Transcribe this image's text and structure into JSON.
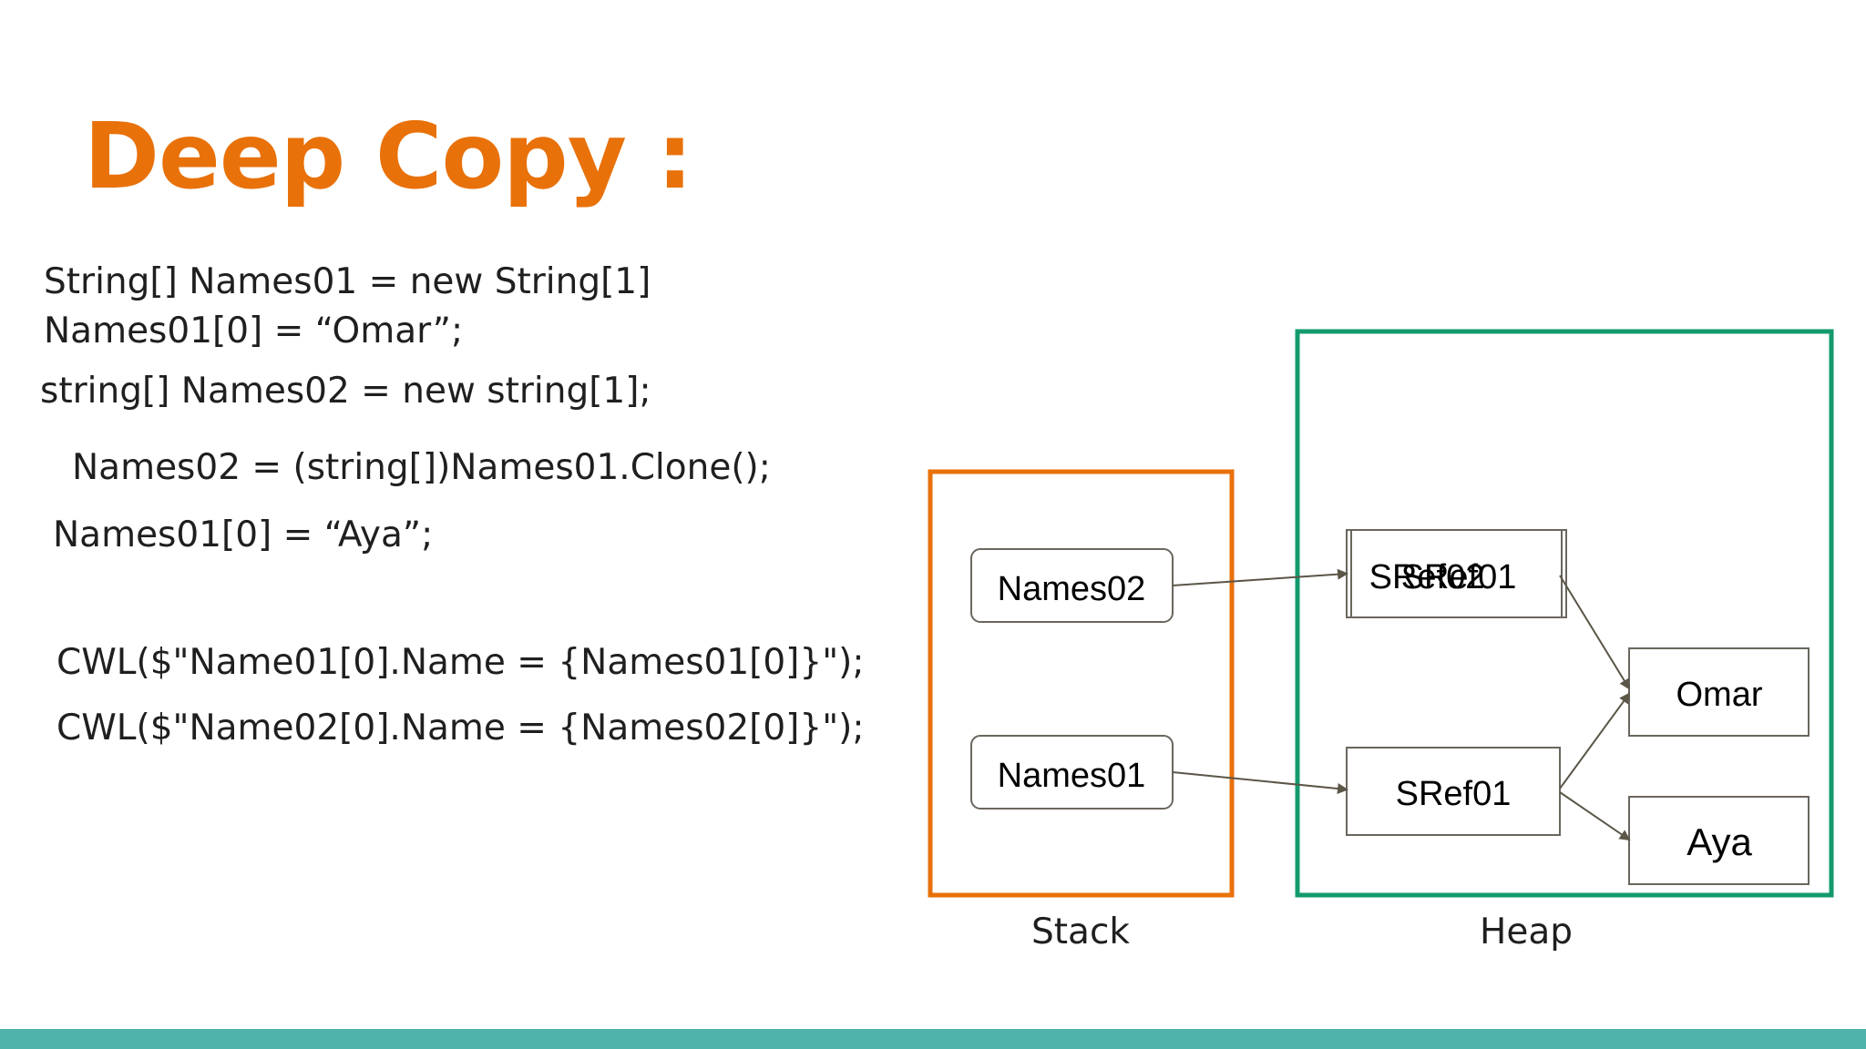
{
  "slide": {
    "title": "Deep Copy :",
    "code_lines": [
      "String[] Names01 = new String[1]",
      "Names01[0] = “Omar”;",
      "string[] Names02 = new string[1];",
      "Names02 = (string[])Names01.Clone();",
      "Names01[0] = “Aya”;",
      "CWL($\"Name01[0].Name = {Names01[0]}\");",
      "CWL($\"Name02[0].Name = {Names02[0]}\");"
    ]
  },
  "diagram": {
    "stack_label": "Stack",
    "heap_label": "Heap",
    "stack_nodes": [
      "Names02",
      "Names01"
    ],
    "heap_nodes": {
      "upper_overlap_a": "SRef02",
      "upper_overlap_b": "SRef01",
      "lower_ref": "SRef01",
      "value_omar": "Omar",
      "value_aya": "Aya"
    },
    "colors": {
      "title": "#e8710a",
      "stack_border": "#e8710a",
      "heap_border": "#139a6c",
      "node_border": "#6b665e",
      "arrow": "#5b5648",
      "bottom_bar": "#4fb3a9"
    }
  }
}
